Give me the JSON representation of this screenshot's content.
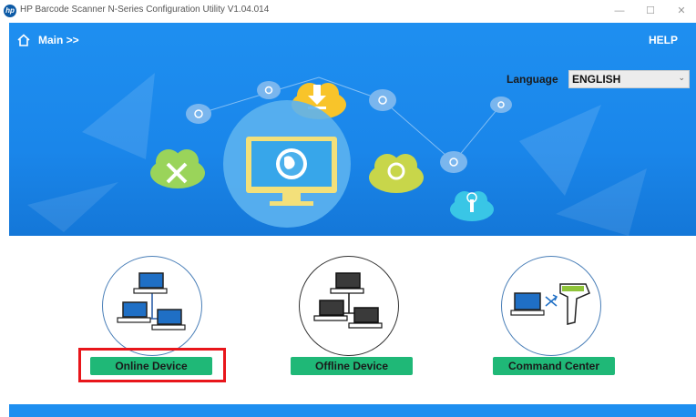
{
  "window": {
    "title": "HP Barcode Scanner N-Series Configuration Utility V1.04.014",
    "logo_text": "hp",
    "controls": [
      "—",
      "☐",
      "✕"
    ]
  },
  "header": {
    "breadcrumb": "Main >>",
    "help_label": "HELP"
  },
  "language": {
    "label": "Language",
    "selected": "ENGLISH"
  },
  "cards": [
    {
      "label": "Online Device",
      "icon": "network-computers-icon"
    },
    {
      "label": "Offline Device",
      "icon": "offline-computers-icon"
    },
    {
      "label": "Command Center",
      "icon": "computer-scanner-icon"
    }
  ],
  "colors": {
    "banner": "#1e8ff0",
    "button_green": "#1fb877",
    "highlight": "#e8161b"
  }
}
